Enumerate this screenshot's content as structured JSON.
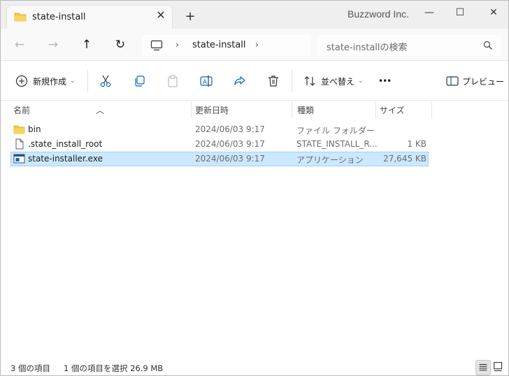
{
  "window": {
    "brand": "Buzzword Inc.",
    "tab": {
      "title": "state-install",
      "close": "✕"
    },
    "new_tab": "+",
    "controls": {
      "minimize": "—",
      "maximize": "☐",
      "close": "✕"
    }
  },
  "nav": {
    "back": "←",
    "forward": "→",
    "up": "↑",
    "refresh": "↻",
    "breadcrumb": {
      "sep1": "›",
      "folder": "state-install",
      "sep2": "›"
    },
    "search_placeholder": "state-installの検索"
  },
  "commands": {
    "new": "新規作成",
    "sort": "並べ替え",
    "more": "•••",
    "preview": "プレビュー"
  },
  "columns": {
    "name": "名前",
    "modified": "更新日時",
    "type": "種類",
    "size": "サイズ"
  },
  "files": [
    {
      "name": "bin",
      "modified": "2024/06/03 9:17",
      "type": "ファイル フォルダー",
      "size": "",
      "icon": "folder-icon"
    },
    {
      "name": ".state_install_root",
      "modified": "2024/06/03 9:17",
      "type": "STATE_INSTALL_R...",
      "size": "1 KB",
      "icon": "file-icon"
    },
    {
      "name": "state-installer.exe",
      "modified": "2024/06/03 9:17",
      "type": "アプリケーション",
      "size": "27,645 KB",
      "icon": "app-icon"
    }
  ],
  "status": {
    "count": "3 個の項目",
    "selection": "1 個の項目を選択  26.9 MB"
  },
  "colors": {
    "accent": "#0067c0",
    "folder": "#f4c542",
    "selection_bg": "#cce8ff",
    "selection_border": "#99d1ff"
  }
}
